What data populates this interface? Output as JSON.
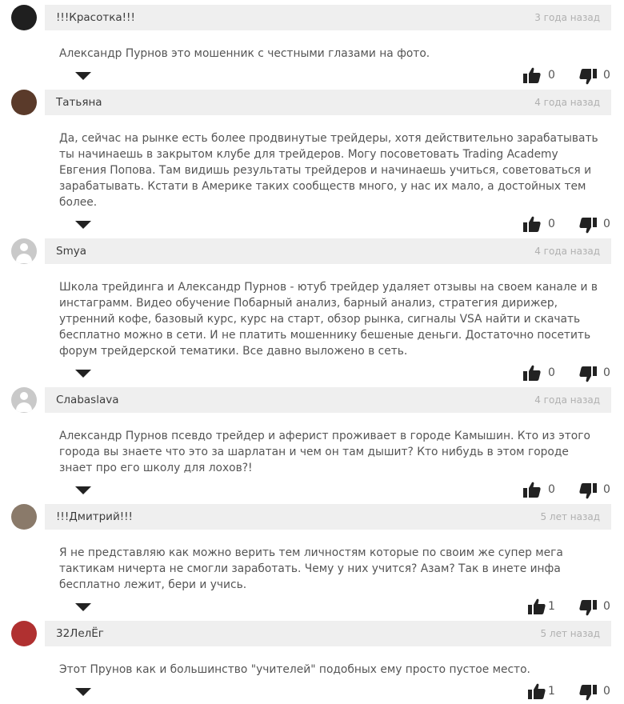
{
  "comments": [
    {
      "author": "!!!Красотка!!!",
      "date": "3 года назад",
      "text": "Александр Пурнов это мошенник с честными глазами на фото.",
      "likes": "0",
      "dislikes": "0",
      "avatar": "photo",
      "avatar_color": "#1f1f1f"
    },
    {
      "author": "Татьяна",
      "date": "4 года назад",
      "text": "Да, сейчас на рынке есть более продвинутые трейдеры, хотя действительно зарабатывать ты начинаешь в закрытом клубе для трейдеров. Могу посоветовать Trading Academy Евгения Попова. Там видишь результаты трейдеров и начинаешь учиться, советоваться и зарабатывать. Кстати в Америке таких сообществ много, у нас их мало, а достойных тем более.",
      "likes": "0",
      "dislikes": "0",
      "avatar": "photo",
      "avatar_color": "#5a3a2a"
    },
    {
      "author": "Smya",
      "date": "4 года назад",
      "text": "Школа трейдинга и Александр Пурнов - ютуб трейдер удаляет отзывы на своем канале и в инстаграмм. Видео обучение Побарный анализ, барный анализ, стратегия дирижер, утренний кофе, базовый курс, курс на старт, обзор рынка, сигналы VSA найти и скачать бесплатно можно в сети. И не платить мошеннику бешеные деньги. Достаточно посетить форум трейдерской тематики. Все давно выложено в сеть.",
      "likes": "0",
      "dislikes": "0",
      "avatar": "placeholder",
      "avatar_color": "#c9c9c9"
    },
    {
      "author": "Слаbaslava",
      "date": "4 года назад",
      "text": "Александр Пурнов псевдо трейдер и аферист проживает в городе Камышин. Кто из этого города вы знаете что это за шарлатан и чем он там дышит? Кто нибудь в этом городе знает про его школу для лохов?!",
      "likes": "0",
      "dislikes": "0",
      "avatar": "placeholder",
      "avatar_color": "#c9c9c9"
    },
    {
      "author": "!!!Дмитрий!!!",
      "date": "5 лет назад",
      "text": "Я не представляю как можно верить тем личностям которые по своим же супер мега тактикам ничерта не смогли заработать. Чему у них учится? Азам? Так в инете инфа бесплатно лежит, бери и учись.",
      "likes": "1",
      "dislikes": "0",
      "avatar": "photo",
      "avatar_color": "#8a7a6a"
    },
    {
      "author": "32ЛелЁг",
      "date": "5 лет назад",
      "text": "Этот Прунов как и большинство \"учителей\" подобных ему просто пустое место.",
      "likes": "1",
      "dislikes": "0",
      "avatar": "photo",
      "avatar_color": "#b03030"
    }
  ]
}
